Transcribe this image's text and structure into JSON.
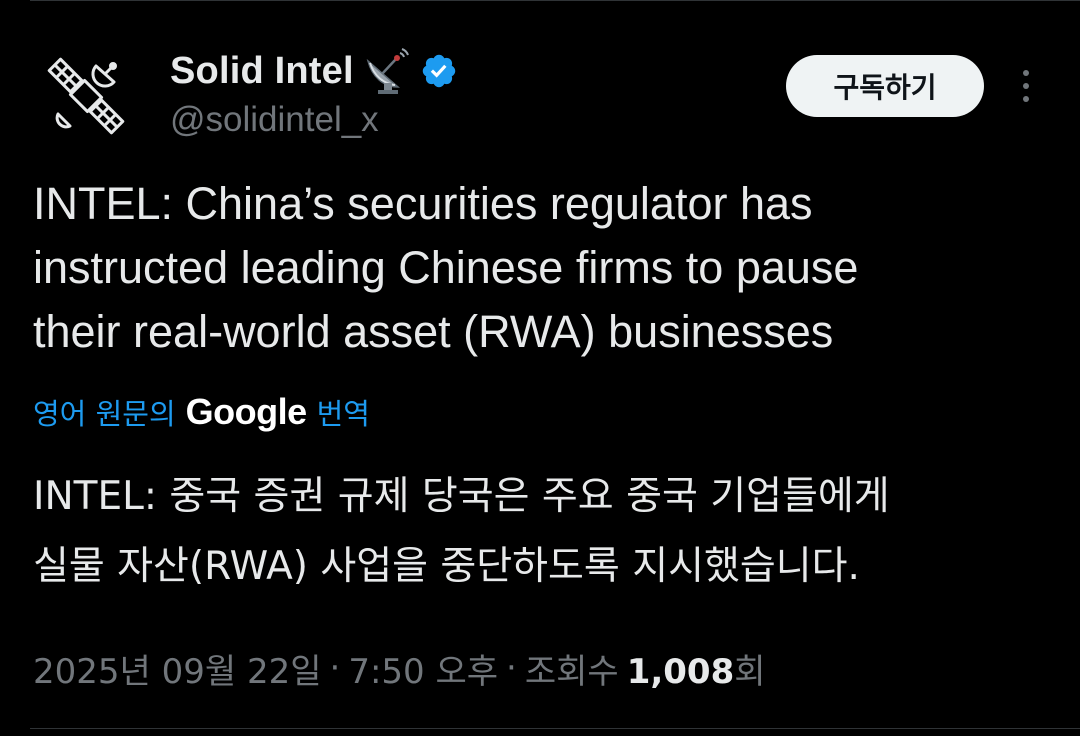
{
  "tweet": {
    "author": {
      "display_name": "Solid Intel",
      "handle": "@solidintel_x",
      "emoji_icon": "satellite-dish-icon",
      "verified_icon": "verified-badge-icon",
      "avatar_icon": "satellite-icon"
    },
    "subscribe_label": "구독하기",
    "more_icon": "more-icon",
    "text": "INTEL: China’s securities regulator has\ninstructed leading Chinese firms to pause\ntheir real-world asset (RWA) businesses",
    "translation": {
      "prefix": "영어 원문의",
      "provider": "Google",
      "suffix": "번역",
      "text": "INTEL: 중국 증권 규제 당국은 주요 중국 기업들에게\n실물 자산(RWA) 사업을 중단하도록 지시했습니다."
    },
    "meta": {
      "date": "2025년 09월 22일",
      "separator1": "·",
      "time": "7:50 오후",
      "separator2": "·",
      "views_label": "조회수",
      "views_count": "1,008",
      "views_suffix": "회"
    }
  },
  "colors": {
    "background": "#000000",
    "text": "#e7e9ea",
    "secondary": "#71767b",
    "link": "#1d9bf0",
    "verified": "#1d9bf0"
  }
}
